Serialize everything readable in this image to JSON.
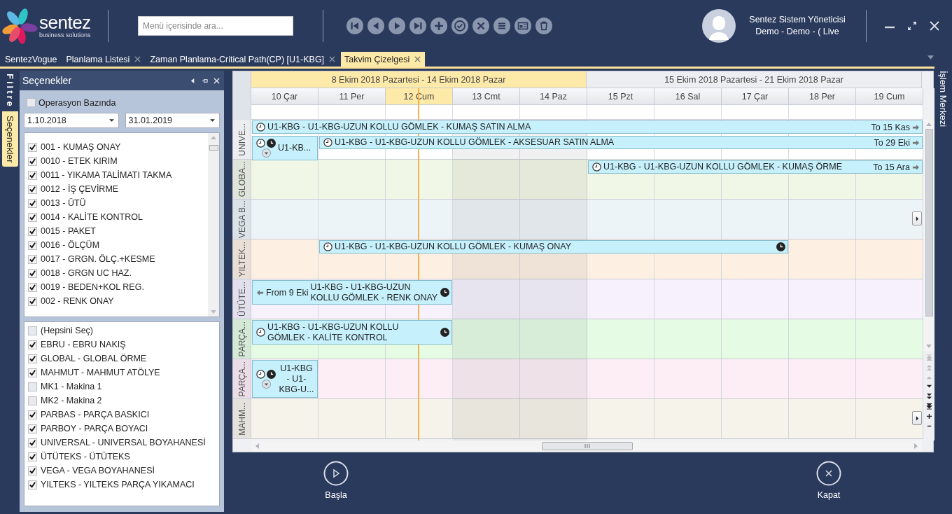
{
  "header": {
    "logo": {
      "name": "sentez",
      "tagline": "business solutions"
    },
    "search": {
      "placeholder": "Menü içerisinde ara..."
    },
    "user": {
      "name": "Sentez Sistem Yöneticisi",
      "detail": "Demo - Demo - ( Live"
    }
  },
  "tabs": [
    {
      "label": "SentezVogue",
      "closable": false,
      "selected": false
    },
    {
      "label": "Planlama Listesi",
      "closable": true,
      "selected": false
    },
    {
      "label": "Zaman Planlama-Critical Path(CP) [U1-KBG]",
      "closable": true,
      "selected": false
    },
    {
      "label": "Takvim Çizelgesi",
      "closable": true,
      "selected": true
    }
  ],
  "side_tabs": [
    {
      "label": "Filtre",
      "selected": false
    },
    {
      "label": "Seçenekler",
      "selected": true
    }
  ],
  "panel": {
    "title": "Seçenekler",
    "operation_based": {
      "label": "Operasyon Bazında",
      "checked": false
    },
    "date_from": "1.10.2018",
    "date_to": "31.01.2019",
    "operations": [
      {
        "label": "001 - KUMAŞ ONAY",
        "checked": true
      },
      {
        "label": "0010 - ETEK KIRIM",
        "checked": true
      },
      {
        "label": "0011 - YIKAMA TALİMATI TAKMA",
        "checked": true
      },
      {
        "label": "0012 - İŞ ÇEVİRME",
        "checked": true
      },
      {
        "label": "0013 - ÜTÜ",
        "checked": true
      },
      {
        "label": "0014 - KALİTE KONTROL",
        "checked": true
      },
      {
        "label": "0015 - PAKET",
        "checked": true
      },
      {
        "label": "0016 - ÖLÇÜM",
        "checked": true
      },
      {
        "label": "0017 - GRGN. ÖLÇ.+KESME",
        "checked": true
      },
      {
        "label": "0018 - GRGN UC HAZ.",
        "checked": true
      },
      {
        "label": "0019 - BEDEN+KOL REG.",
        "checked": true
      },
      {
        "label": "002 - RENK ONAY",
        "checked": true
      }
    ],
    "workshops": [
      {
        "label": "(Hepsini Seç)",
        "checked": false
      },
      {
        "label": "EBRU - EBRU NAKIŞ",
        "checked": true
      },
      {
        "label": "GLOBAL - GLOBAL ÖRME",
        "checked": true
      },
      {
        "label": "MAHMUT - MAHMUT ATÖLYE",
        "checked": true
      },
      {
        "label": "MK1 - Makina 1",
        "checked": false
      },
      {
        "label": "MK2 - Makina 2",
        "checked": false
      },
      {
        "label": "PARBAS - PARÇA BASKICI",
        "checked": true
      },
      {
        "label": "PARBOY - PARÇA BOYACI",
        "checked": true
      },
      {
        "label": "UNIVERSAL - UNIVERSAL BOYAHANESİ",
        "checked": true
      },
      {
        "label": "ÜTÜTEKS - ÜTÜTEKS",
        "checked": true
      },
      {
        "label": "VEGA - VEGA BOYAHANESİ",
        "checked": true
      },
      {
        "label": "YILTEKS - YILTEKS PARÇA YIKAMACI",
        "checked": true
      }
    ]
  },
  "scheduler": {
    "weeks": [
      {
        "label": "8 Ekim 2018 Pazartesi - 14 Ekim 2018 Pazar",
        "selected": true
      },
      {
        "label": "15 Ekim 2018 Pazartesi - 21 Ekim 2018 Pazar",
        "selected": false
      }
    ],
    "days": [
      {
        "label": "10 Çar",
        "selected": false,
        "weekend": false
      },
      {
        "label": "11 Per",
        "selected": false,
        "weekend": false
      },
      {
        "label": "12 Cum",
        "selected": true,
        "weekend": false
      },
      {
        "label": "13 Cmt",
        "selected": false,
        "weekend": true
      },
      {
        "label": "14 Paz",
        "selected": false,
        "weekend": true
      },
      {
        "label": "15 Pzt",
        "selected": false,
        "weekend": false
      },
      {
        "label": "16 Sal",
        "selected": false,
        "weekend": false
      },
      {
        "label": "17 Çar",
        "selected": false,
        "weekend": false
      },
      {
        "label": "18 Per",
        "selected": false,
        "weekend": false
      },
      {
        "label": "19 Cum",
        "selected": false,
        "weekend": false
      }
    ],
    "resources": [
      {
        "name": "UNIVE...",
        "color": "#ffffff",
        "has_more": false,
        "lanes": [
          [
            {
              "kind": "appointment",
              "text": "U1-KBG - U1-KBG-UZUN KOLLU GÖMLEK - KUMAŞ SATIN ALMA",
              "tall": false,
              "fills_row": false,
              "reminder": false,
              "clock_end": false,
              "to": "To 15 Kas"
            },
            {
              "kind": "continued"
            },
            {
              "kind": "continued"
            },
            {
              "kind": "continued"
            },
            {
              "kind": "continued"
            },
            {
              "kind": "continued"
            },
            {
              "kind": "continued"
            },
            {
              "kind": "continued"
            },
            {
              "kind": "continued"
            },
            {
              "kind": "continued"
            }
          ],
          [
            {
              "kind": "appointment",
              "text": "U1-KB...",
              "tall": true,
              "fills_row": false,
              "reminder": true,
              "clock_end": false
            },
            {
              "kind": "appointment",
              "text": "U1-KBG - U1-KBG-UZUN KOLLU GÖMLEK - AKSESUAR SATIN ALMA",
              "tall": false,
              "fills_row": false,
              "reminder": false,
              "clock_end": false,
              "to": "To 29 Eki"
            },
            {
              "kind": "continued"
            },
            {
              "kind": "continued"
            },
            {
              "kind": "continued"
            },
            {
              "kind": "continued"
            },
            {
              "kind": "continued"
            },
            {
              "kind": "continued"
            },
            {
              "kind": "continued"
            },
            {
              "kind": "continued"
            }
          ]
        ]
      },
      {
        "name": "GLOBA...",
        "color": "#f1f7e7",
        "has_more": false,
        "lanes": [
          [
            {
              "kind": "free"
            },
            {
              "kind": "free"
            },
            {
              "kind": "free"
            },
            {
              "kind": "free"
            },
            {
              "kind": "free"
            },
            {
              "kind": "appointment",
              "text": "U1-KBG - U1-KBG-UZUN KOLLU GÖMLEK - KUMAŞ ÖRME",
              "tall": false,
              "fills_row": false,
              "reminder": false,
              "clock_end": false,
              "to": "To 15 Ara"
            },
            {
              "kind": "continued"
            },
            {
              "kind": "continued"
            },
            {
              "kind": "continued"
            },
            {
              "kind": "continued"
            }
          ]
        ]
      },
      {
        "name": "VEGA B...",
        "color": "#edf4f8",
        "has_more": true
      },
      {
        "name": "YILTEK...",
        "color": "#fdf0e3",
        "has_more": false,
        "lanes": [
          [
            {
              "kind": "free"
            },
            {
              "kind": "appointment",
              "text": "U1-KBG - U1-KBG-UZUN KOLLU GÖMLEK - KUMAŞ ONAY",
              "tall": false,
              "fills_row": false,
              "reminder": false,
              "clock_end": true
            },
            {
              "kind": "continued"
            },
            {
              "kind": "continued"
            },
            {
              "kind": "continued"
            },
            {
              "kind": "continued"
            },
            {
              "kind": "continued"
            },
            {
              "kind": "continued"
            }
          ]
        ]
      },
      {
        "name": "ÜTÜTE...",
        "color": "#f6f1fd",
        "has_more": false,
        "lanes": [
          [
            {
              "kind": "appointment",
              "text": "U1-KBG - U1-KBG-UZUN KOLLU GÖMLEK - RENK ONAY",
              "tall": true,
              "fills_row": false,
              "reminder": false,
              "clock_end": true,
              "from": "From 9 Eki"
            },
            {
              "kind": "continued"
            },
            {
              "kind": "continued"
            }
          ]
        ]
      },
      {
        "name": "PARÇA...",
        "color": "#e5fbe3",
        "has_more": false,
        "lanes": [
          [
            {
              "kind": "appointment",
              "text": "U1-KBG - U1-KBG-UZUN KOLLU GÖMLEK - KALİTE KONTROL",
              "tall": true,
              "fills_row": false,
              "reminder": false,
              "clock_end": true
            },
            {
              "kind": "continued"
            },
            {
              "kind": "continued"
            }
          ]
        ]
      },
      {
        "name": "PARÇA...",
        "color": "#fdeef6",
        "has_more": false,
        "lanes": [
          [
            {
              "kind": "appointment",
              "text": "U1-KBG - U1-KBG-U...",
              "tall": false,
              "fills_row": true,
              "reminder": true,
              "clock_end": false
            }
          ]
        ]
      },
      {
        "name": "MAHM...",
        "color": "#f6f3ea",
        "has_more": true
      }
    ]
  },
  "right_tab": {
    "label": "İşlem Merkezi"
  },
  "footer": [
    {
      "label": "Başla",
      "kind": "start"
    },
    {
      "label": "Kapat",
      "kind": "close"
    }
  ]
}
